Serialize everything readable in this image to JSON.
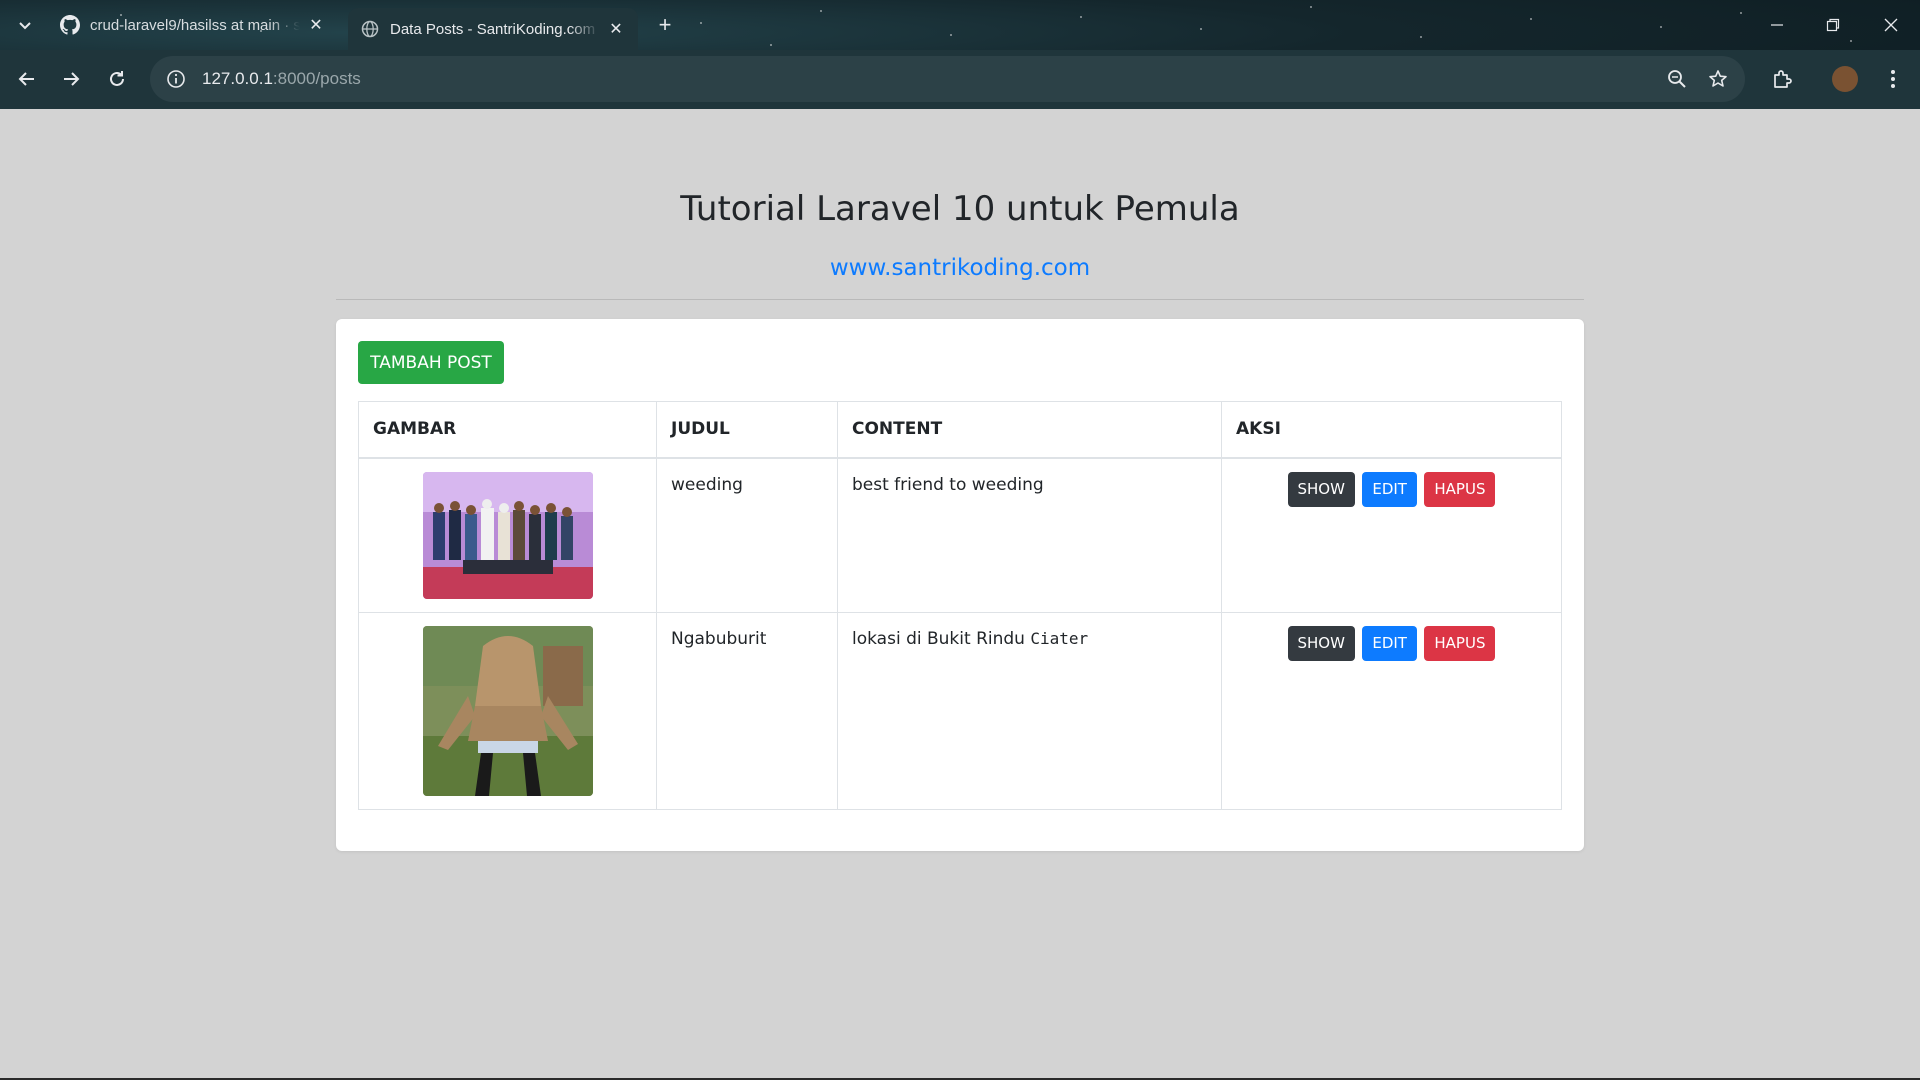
{
  "browser": {
    "tabs": [
      {
        "title": "crud-laravel9/hasilss at main · s",
        "active": false,
        "icon": "github-icon"
      },
      {
        "title": "Data Posts - SantriKoding.com",
        "active": true,
        "icon": "globe-icon"
      }
    ],
    "url_host": "127.0.0.1",
    "url_path": ":8000/posts"
  },
  "page": {
    "title": "Tutorial Laravel 10 untuk Pemula",
    "link": "www.santrikoding.com",
    "add_button": "TAMBAH POST"
  },
  "table": {
    "headers": [
      "GAMBAR",
      "JUDUL",
      "CONTENT",
      "AKSI"
    ],
    "rows": [
      {
        "judul": "weeding",
        "content": "best friend to weeding",
        "content_code": ""
      },
      {
        "judul": "Ngabuburit",
        "content": "lokasi di Bukit Rindu ",
        "content_code": "Ciater"
      }
    ],
    "actions": {
      "show": "SHOW",
      "edit": "EDIT",
      "hapus": "HAPUS"
    }
  },
  "colors": {
    "page_bg": "#d3d3d3",
    "add_button": "#28a745",
    "show_button": "#343a40",
    "edit_button": "#0d7bff",
    "hapus_button": "#dc3545",
    "link": "#0d7bff"
  }
}
